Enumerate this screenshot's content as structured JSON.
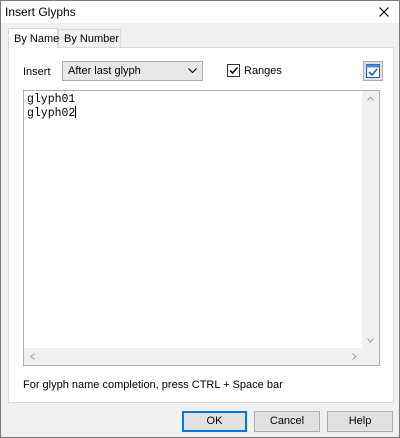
{
  "window": {
    "title": "Insert Glyphs"
  },
  "tabs": [
    {
      "label": "By Name",
      "active": true
    },
    {
      "label": "By Number",
      "active": false
    }
  ],
  "insert": {
    "label": "Insert",
    "selected": "After last glyph"
  },
  "ranges": {
    "label": "Ranges",
    "checked": true
  },
  "editor": {
    "lines": [
      "glyph01",
      "glyph02"
    ]
  },
  "hint": "For glyph name completion, press CTRL + Space bar",
  "buttons": {
    "ok": "OK",
    "cancel": "Cancel",
    "help": "Help"
  },
  "icons": {
    "close": "close-icon",
    "dropdown": "chevron-down-icon",
    "check": "checkmark-icon",
    "apply": "apply-icon"
  },
  "colors": {
    "accent": "#0078d7"
  }
}
